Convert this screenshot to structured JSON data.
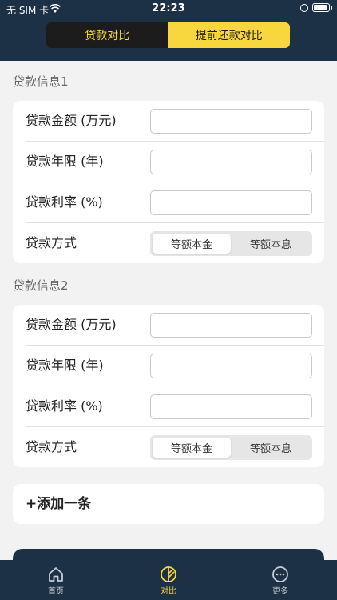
{
  "status_bar": {
    "carrier": "无 SIM 卡",
    "time": "22:23",
    "battery_level": 0.9
  },
  "segments": {
    "left": "贷款对比",
    "right": "提前还款对比",
    "selected": "贷款对比"
  },
  "sections": [
    {
      "title": "贷款信息1",
      "amount_label": "贷款金额 (万元)",
      "amount_value": "",
      "years_label": "贷款年限 (年)",
      "years_value": "",
      "rate_label": "贷款利率 (%)",
      "rate_value": "",
      "method_label": "贷款方式",
      "method_options": [
        "等额本金",
        "等额本息"
      ],
      "method_selected": "等额本金"
    },
    {
      "title": "贷款信息2",
      "amount_label": "贷款金额 (万元)",
      "amount_value": "",
      "years_label": "贷款年限 (年)",
      "years_value": "",
      "rate_label": "贷款利率 (%)",
      "rate_value": "",
      "method_label": "贷款方式",
      "method_options": [
        "等额本金",
        "等额本息"
      ],
      "method_selected": "等额本金"
    }
  ],
  "add_item": {
    "label": "+添加一条"
  },
  "tabbar": {
    "items": [
      {
        "label": "首页",
        "icon": "home-icon"
      },
      {
        "label": "对比",
        "icon": "compare-icon"
      },
      {
        "label": "更多",
        "icon": "more-icon"
      }
    ],
    "active_index": 1
  },
  "colors": {
    "header_bg": "#1d3146",
    "accent_yellow": "#f8d73e",
    "segment_dark": "#1c1c1c",
    "page_bg": "#f2f2f2"
  }
}
